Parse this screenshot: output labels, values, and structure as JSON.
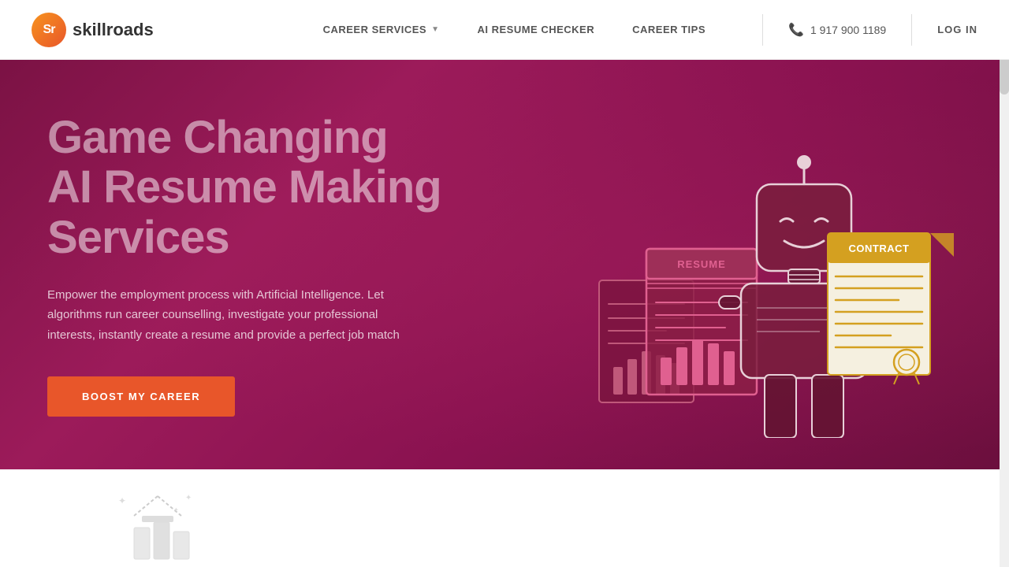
{
  "brand": {
    "initials": "Sr",
    "name": "skillroads"
  },
  "nav": {
    "links": [
      {
        "id": "career-services",
        "label": "CAREER SERVICES",
        "hasDropdown": true
      },
      {
        "id": "ai-resume-checker",
        "label": "AI RESUME CHECKER",
        "hasDropdown": false
      },
      {
        "id": "career-tips",
        "label": "CAREER TIPS",
        "hasDropdown": false
      }
    ],
    "phone": "1 917 900 1189",
    "login_label": "LOG IN"
  },
  "hero": {
    "title_line1": "Game Changing",
    "title_line2": "AI Resume Making",
    "title_line3": "Services",
    "description": "Empower the employment process with Artificial Intelligence. Let algorithms run career counselling, investigate your professional interests, instantly create a resume and provide a perfect job match",
    "cta_label": "BOOST MY CAREER"
  },
  "colors": {
    "hero_bg": "#8a1250",
    "cta_bg": "#e8562a",
    "logo_gradient_start": "#f7931e",
    "logo_gradient_end": "#e8562a"
  },
  "illustration": {
    "resume_label": "RESUME",
    "contract_label": "CONTRACT"
  }
}
